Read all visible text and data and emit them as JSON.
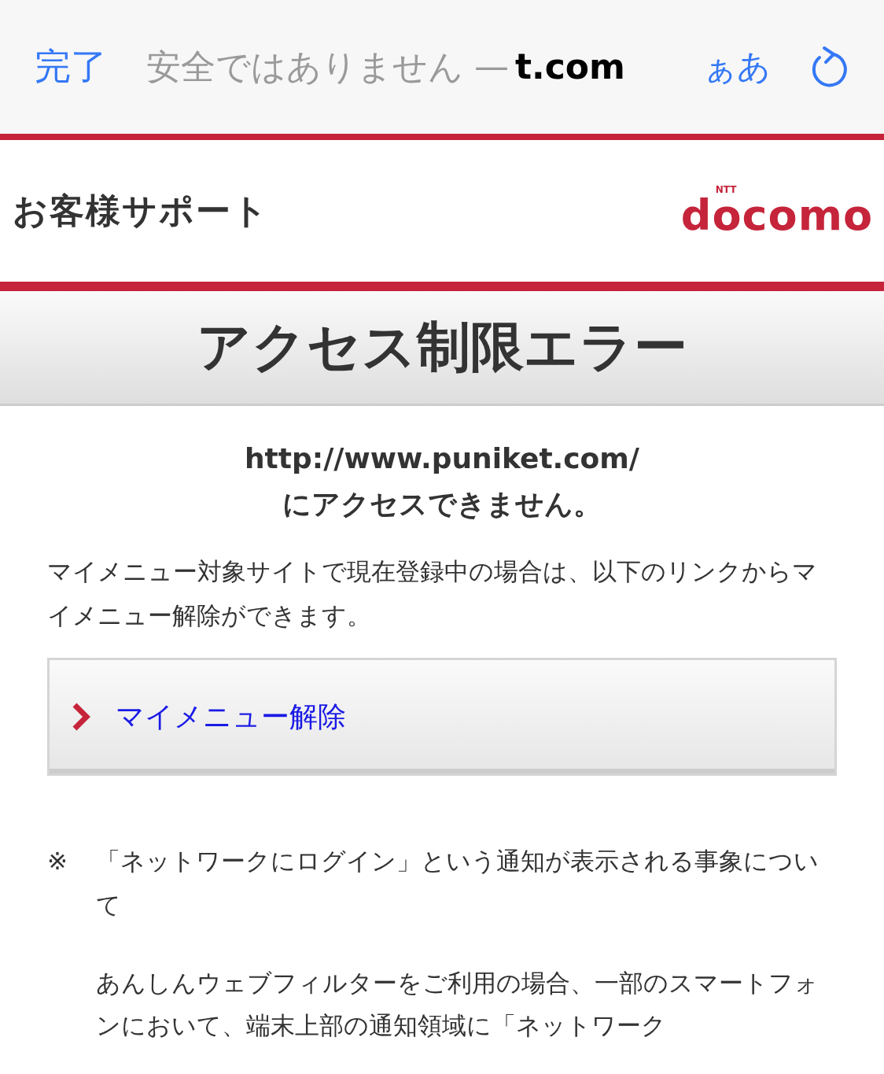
{
  "browser_bar": {
    "done_button": "完了",
    "security_notice": "安全ではありません —",
    "domain": "t.com",
    "text_size_button": "ぁあ"
  },
  "header": {
    "title": "お客様サポート",
    "logo": {
      "superscript": "NTT",
      "brand": "docomo"
    }
  },
  "page_title": "アクセス制限エラー",
  "error": {
    "url": "http://www.puniket.com/",
    "message": "にアクセスできません。"
  },
  "intro": "マイメニュー対象サイトで現在登録中の場合は、以下のリンクからマイメニュー解除ができます。",
  "link_button": {
    "label": "マイメニュー解除"
  },
  "notice": {
    "mark": "※",
    "title": "「ネットワークにログイン」という通知が表示される事象について",
    "body": "あんしんウェブフィルターをご利用の場合、一部のスマートフォンにおいて、端末上部の通知領域に「ネットワーク"
  }
}
